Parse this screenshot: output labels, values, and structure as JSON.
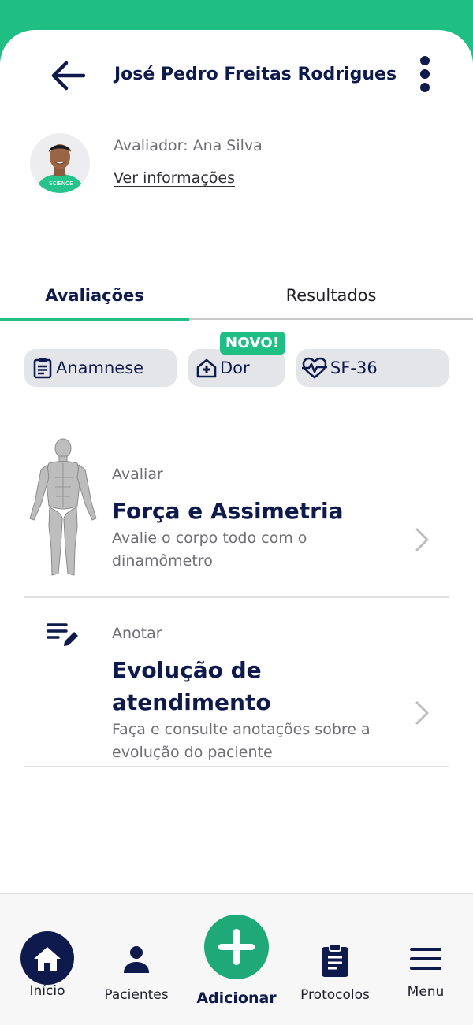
{
  "colors": {
    "brand_green": "#1FBF83",
    "navy": "#0E1A4B",
    "chip_bg": "#E3E5E9",
    "muted_text": "#6E6E73"
  },
  "header": {
    "back_icon": "arrow-left-icon",
    "title": "José Pedro Freitas Rodrigues",
    "more_icon": "more-vertical-icon"
  },
  "profile": {
    "evaluator": "Avaliador: Ana Silva",
    "view_info": "Ver informações"
  },
  "tabs": [
    {
      "label": "Avaliações",
      "active": true
    },
    {
      "label": "Resultados",
      "active": false
    }
  ],
  "chips": [
    {
      "label": "Anamnese",
      "icon": "clipboard-list-icon"
    },
    {
      "label": "Dor",
      "icon": "medical-house-icon",
      "badge": "NOVO!"
    },
    {
      "label": "SF-36",
      "icon": "heart-pulse-icon"
    }
  ],
  "cards": [
    {
      "kicker": "Avaliar",
      "title": "Força e Assimetria",
      "description": "Avalie o corpo todo com o dinamômetro",
      "icon": "body-muscles-icon"
    },
    {
      "kicker": "Anotar",
      "title": "Evolução de atendimento",
      "description": "Faça e consulte anotações sobre a evolução do paciente",
      "icon": "edit-notes-icon"
    }
  ],
  "bottom_nav": [
    {
      "label": "Início",
      "icon": "home-icon",
      "active": true
    },
    {
      "label": "Pacientes",
      "icon": "person-icon"
    },
    {
      "label": "Adicionar",
      "icon": "plus-icon"
    },
    {
      "label": "Protocolos",
      "icon": "clipboard-icon"
    },
    {
      "label": "Menu",
      "icon": "hamburger-menu-icon"
    }
  ]
}
